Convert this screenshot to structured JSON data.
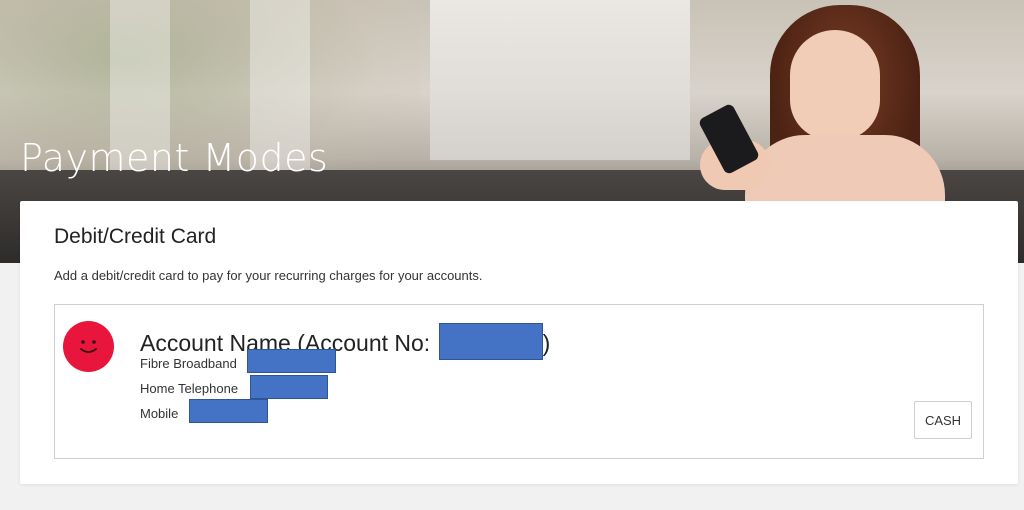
{
  "hero": {
    "title": "Payment Modes"
  },
  "card": {
    "title": "Debit/Credit Card",
    "description": "Add a debit/credit card to pay for your recurring charges for your accounts."
  },
  "account": {
    "name_prefix": "Account Name (Account No: ",
    "name_suffix": ")",
    "avatar_icon": "smiley-face-icon",
    "avatar_color": "#e8163c",
    "services": [
      {
        "label": "Fibre Broadband"
      },
      {
        "label": "Home Telephone"
      },
      {
        "label": "Mobile"
      }
    ]
  },
  "actions": {
    "cash_label": "CASH"
  },
  "colors": {
    "redaction": "#4472c4"
  }
}
